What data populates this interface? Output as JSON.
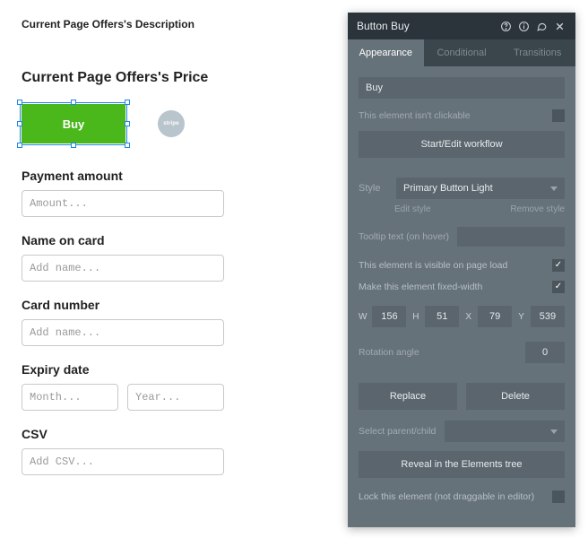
{
  "canvas": {
    "descTitle": "Current Page Offers's Description",
    "priceTitle": "Current Page Offers's Price",
    "buyLabel": "Buy",
    "stripeChip": "stripe",
    "fields": {
      "paymentAmount": {
        "label": "Payment amount",
        "placeholder": "Amount..."
      },
      "nameOnCard": {
        "label": "Name on card",
        "placeholder": "Add name..."
      },
      "cardNumber": {
        "label": "Card number",
        "placeholder": "Add name..."
      },
      "expiry": {
        "label": "Expiry date",
        "monthPlaceholder": "Month...",
        "yearPlaceholder": "Year..."
      },
      "csv": {
        "label": "CSV",
        "placeholder": "Add CSV..."
      }
    }
  },
  "panel": {
    "title": "Button Buy",
    "tabs": {
      "appearance": "Appearance",
      "conditional": "Conditional",
      "transitions": "Transitions"
    },
    "nameValue": "Buy",
    "notClickable": "This element isn't clickable",
    "startEditWorkflow": "Start/Edit workflow",
    "styleLabel": "Style",
    "styleValue": "Primary Button Light",
    "editStyle": "Edit style",
    "removeStyle": "Remove style",
    "tooltipLabel": "Tooltip text (on hover)",
    "visibleLabel": "This element is visible on page load",
    "fixedWidthLabel": "Make this element fixed-width",
    "dims": {
      "W": "156",
      "H": "51",
      "X": "79",
      "Y": "539",
      "wLabel": "W",
      "hLabel": "H",
      "xLabel": "X",
      "yLabel": "Y"
    },
    "rotationLabel": "Rotation angle",
    "rotationValue": "0",
    "replace": "Replace",
    "delete": "Delete",
    "selectParentLabel": "Select parent/child",
    "revealLabel": "Reveal in the Elements tree",
    "lockLabel": "Lock this element (not draggable in editor)"
  }
}
